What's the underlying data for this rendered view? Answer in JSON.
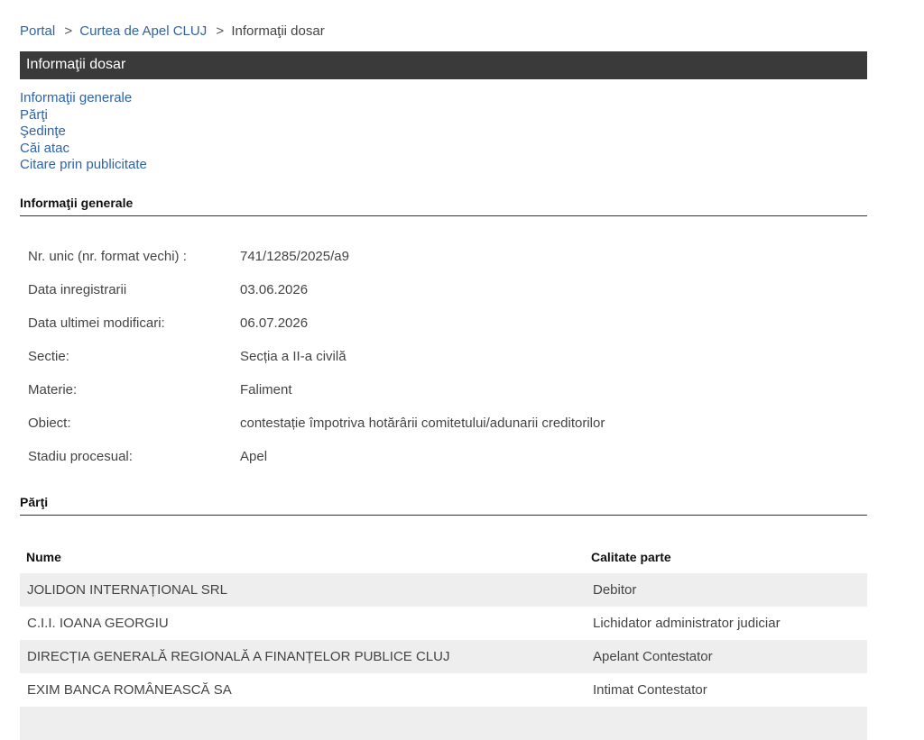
{
  "breadcrumb": {
    "portal": "Portal",
    "court": "Curtea de Apel CLUJ",
    "current": "Informaţii dosar",
    "separator": ">"
  },
  "title": "Informaţii dosar",
  "nav": [
    "Informaţii generale",
    "Părţi",
    "Şedinţe",
    "Căi atac",
    "Citare prin publicitate"
  ],
  "general": {
    "heading": "Informaţii generale",
    "rows": [
      {
        "label": "Nr. unic (nr. format vechi) :",
        "value": "741/1285/2025/a9"
      },
      {
        "label": "Data inregistrarii",
        "value": "03.06.2026"
      },
      {
        "label": "Data ultimei modificari:",
        "value": "06.07.2026"
      },
      {
        "label": "Sectie:",
        "value": "Secția a II-a civilă"
      },
      {
        "label": "Materie:",
        "value": "Faliment"
      },
      {
        "label": "Obiect:",
        "value": "contestație împotriva hotărârii comitetului/adunarii creditorilor"
      },
      {
        "label": "Stadiu procesual:",
        "value": "Apel"
      }
    ]
  },
  "parties": {
    "heading": "Părţi",
    "columns": [
      "Nume",
      "Calitate parte"
    ],
    "rows": [
      {
        "name": "JOLIDON INTERNAȚIONAL SRL",
        "role": "Debitor"
      },
      {
        "name": "C.I.I. IOANA GEORGIU",
        "role": "Lichidator administrator judiciar"
      },
      {
        "name": "DIRECȚIA GENERALĂ REGIONALĂ A FINANȚELOR PUBLICE CLUJ",
        "role": "Apelant Contestator"
      },
      {
        "name": "EXIM BANCA ROMÂNEASCĂ SA",
        "role": "Intimat Contestator"
      },
      {
        "name": "",
        "role": ""
      }
    ]
  },
  "colors": {
    "link": "#2f63a8",
    "title_bar": "#3a3a3a",
    "row_alt": "#eeeeee"
  }
}
